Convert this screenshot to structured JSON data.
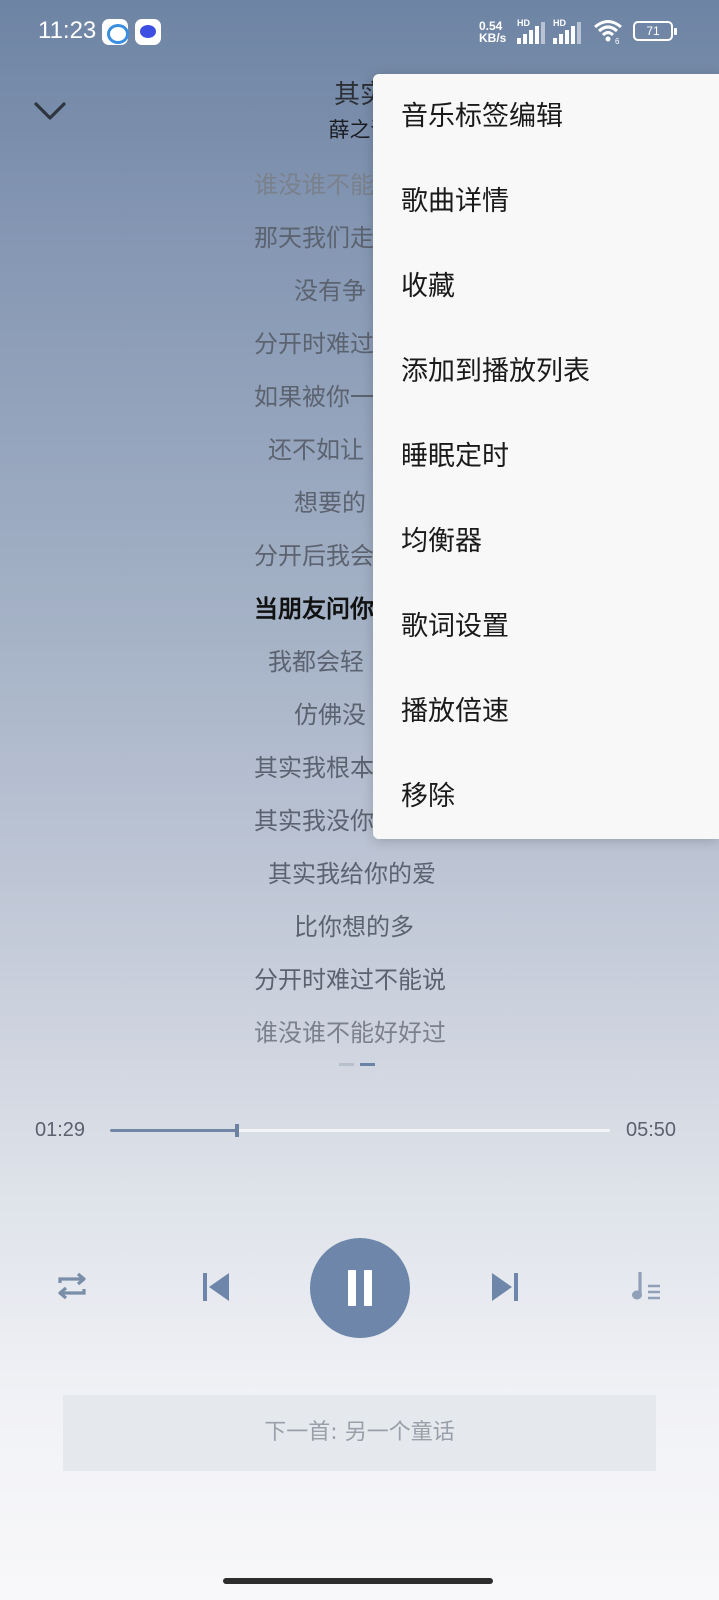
{
  "status_bar": {
    "time": "11:23",
    "net_speed_value": "0.54",
    "net_speed_unit": "KB/s",
    "sim1_label": "HD",
    "sim2_label": "HD",
    "wifi_label": "6",
    "battery": "71"
  },
  "player": {
    "title": "其实",
    "artist": "薛之谦",
    "lyrics": [
      "谁没谁不能",
      "那天我们走",
      "没有争",
      "分开时难过",
      "如果被你一",
      "还不如让",
      "想要的",
      "分开后我会",
      "当朋友问你",
      "我都会轻",
      "仿佛没",
      "其实我根本",
      "其实我没你",
      "其实我给你的爱",
      "比你想的多",
      "分开时难过不能说",
      "谁没谁不能好好过"
    ],
    "current_lyric_index": 8,
    "time_current": "01:29",
    "time_total": "05:50",
    "progress": 0.2543,
    "next_song_label": "下一首: 另一个童话"
  },
  "menu": {
    "items": [
      "音乐标签编辑",
      "歌曲详情",
      "收藏",
      "添加到播放列表",
      "睡眠定时",
      "均衡器",
      "歌词设置",
      "播放倍速",
      "移除"
    ]
  },
  "colors": {
    "accent": "#6e86a9",
    "menu_bg": "#f8f8f9"
  },
  "icons": {
    "collapse": "chevron-down-icon",
    "repeat": "repeat-icon",
    "prev": "skip-previous-icon",
    "play_pause": "pause-icon",
    "next": "skip-next-icon",
    "playlist": "playlist-icon"
  }
}
